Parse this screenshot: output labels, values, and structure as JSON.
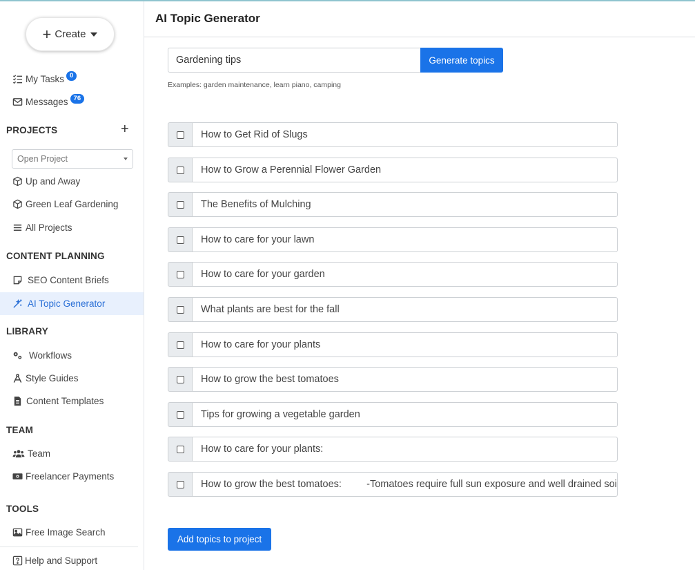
{
  "sidebar": {
    "create_label": "Create",
    "my_tasks": {
      "label": "My Tasks",
      "count": "0"
    },
    "messages": {
      "label": "Messages",
      "count": "76"
    },
    "projects_heading": "PROJECTS",
    "open_project_placeholder": "Open Project",
    "projects": [
      "Up and Away",
      "Green Leaf Gardening"
    ],
    "all_projects": "All Projects",
    "content_planning_heading": "CONTENT PLANNING",
    "seo_briefs": "SEO Content Briefs",
    "ai_topic_generator": "AI Topic Generator",
    "library_heading": "LIBRARY",
    "workflows": "Workflows",
    "style_guides": "Style Guides",
    "content_templates": "Content Templates",
    "team_heading": "TEAM",
    "team": "Team",
    "freelancer_payments": "Freelancer Payments",
    "tools_heading": "TOOLS",
    "free_image_search": "Free Image Search",
    "help": "Help and Support"
  },
  "main": {
    "title": "AI Topic Generator",
    "search_value": "Gardening tips",
    "generate_label": "Generate topics",
    "examples": "Examples: garden maintenance, learn piano, camping",
    "topics": [
      "How to Get Rid of Slugs",
      "How to Grow a Perennial Flower Garden",
      "The Benefits of Mulching",
      "How to care for your lawn",
      "How to care for your garden",
      "What plants are best for the fall",
      "How to care for your plants",
      "How to grow the best tomatoes",
      "Tips for growing a vegetable garden",
      "How to care for your plants:",
      "How to grow the best tomatoes:         -Tomatoes require full sun exposure and well drained soil"
    ],
    "add_label": "Add topics to project"
  },
  "colors": {
    "accent": "#1a73e8",
    "active_bg": "#e8f0fd"
  }
}
